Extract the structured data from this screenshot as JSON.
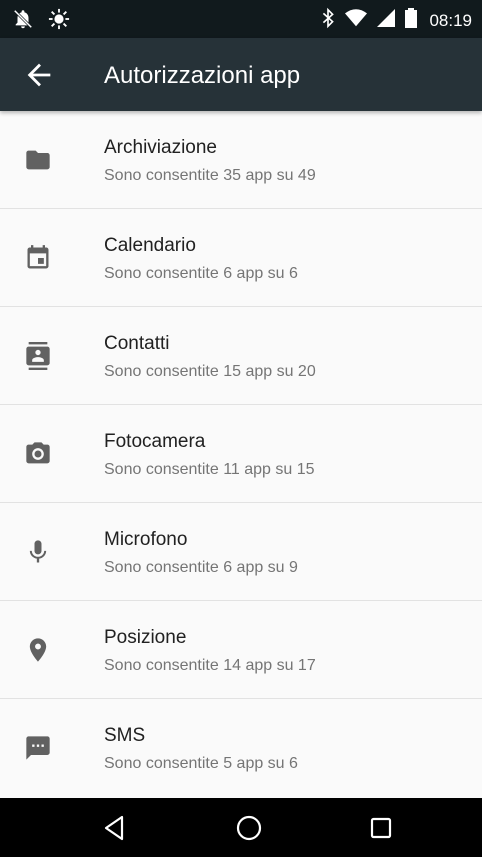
{
  "status_bar": {
    "time": "08:19",
    "icons": [
      "notification-off-icon",
      "brightness-icon",
      "bluetooth-icon",
      "wifi-icon",
      "signal-icon",
      "battery-icon"
    ]
  },
  "app_bar": {
    "title": "Autorizzazioni app",
    "back_icon": "arrow-back-icon"
  },
  "permissions": [
    {
      "icon": "folder-icon",
      "title": "Archiviazione",
      "subtitle": "Sono consentite 35 app su 49"
    },
    {
      "icon": "calendar-icon",
      "title": "Calendario",
      "subtitle": "Sono consentite 6 app su 6"
    },
    {
      "icon": "contacts-icon",
      "title": "Contatti",
      "subtitle": "Sono consentite 15 app su 20"
    },
    {
      "icon": "camera-icon",
      "title": "Fotocamera",
      "subtitle": "Sono consentite 11 app su 15"
    },
    {
      "icon": "microphone-icon",
      "title": "Microfono",
      "subtitle": "Sono consentite 6 app su 9"
    },
    {
      "icon": "location-icon",
      "title": "Posizione",
      "subtitle": "Sono consentite 14 app su 17"
    },
    {
      "icon": "sms-icon",
      "title": "SMS",
      "subtitle": "Sono consentite 5 app su 6"
    }
  ],
  "nav_bar": {
    "buttons": [
      "back-triangle-icon",
      "home-circle-icon",
      "recents-square-icon"
    ]
  },
  "colors": {
    "status_bar": "#111a1d",
    "app_bar": "#263238",
    "background": "#fafafa",
    "icon": "#616161",
    "title_text": "#212121",
    "subtitle_text": "#757575"
  }
}
